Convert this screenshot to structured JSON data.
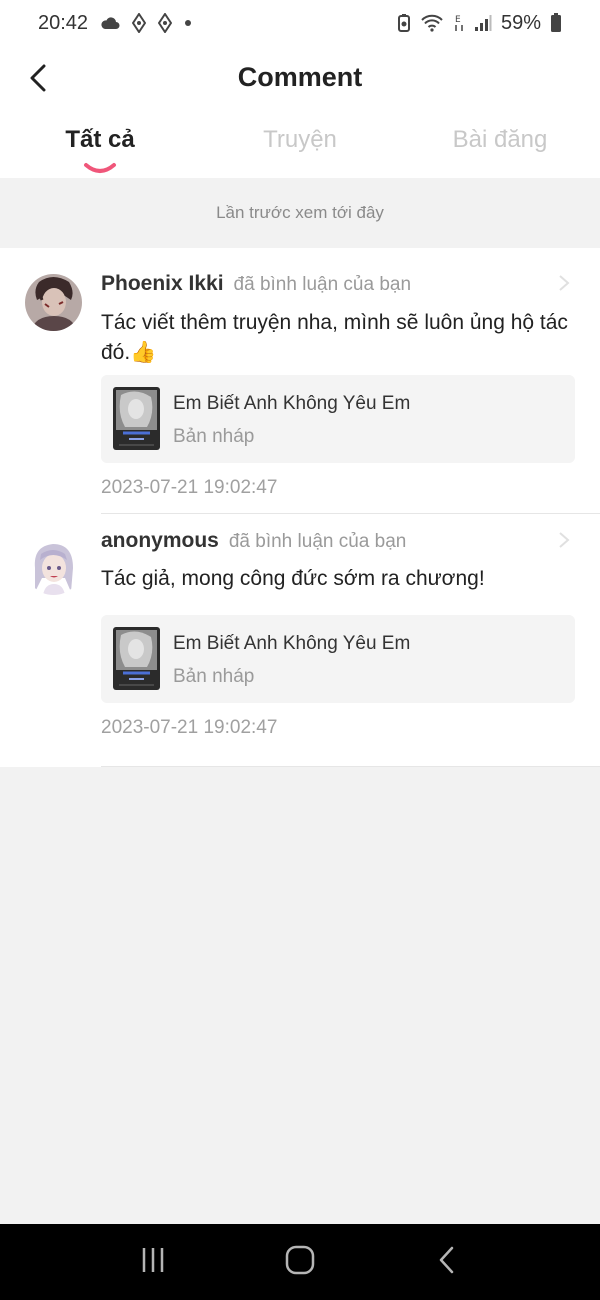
{
  "status_bar": {
    "time": "20:42",
    "battery": "59%",
    "icons": [
      "cloud-icon",
      "app-diamond-icon",
      "app-diamond-icon",
      "dot-icon",
      "battery-saver-icon",
      "wifi-icon",
      "signal-e-icon",
      "signal-icon",
      "battery-icon"
    ]
  },
  "header": {
    "title": "Comment",
    "back_icon": "back-arrow-icon"
  },
  "tabs": [
    {
      "label": "Tất cả",
      "active": true
    },
    {
      "label": "Truyện",
      "active": false
    },
    {
      "label": "Bài đăng",
      "active": false
    }
  ],
  "last_seen": "Lần trước xem tới đây",
  "comments": [
    {
      "username": "Phoenix Ikki",
      "action": "đã bình luận của bạn",
      "text": "Tác viết thêm truyện nha, mình sẽ luôn ủng hộ tác đó.👍",
      "story": {
        "title": "Em Biết Anh Không Yêu Em",
        "status": "Bản nháp"
      },
      "timestamp": "2023-07-21 19:02:47"
    },
    {
      "username": "anonymous",
      "action": "đã bình luận của bạn",
      "text": "Tác giả, mong công đức sớm ra chương!",
      "story": {
        "title": "Em Biết Anh Không Yêu Em",
        "status": "Bản nháp"
      },
      "timestamp": "2023-07-21 19:02:47"
    }
  ],
  "nav_bar": {
    "icons": [
      "recent-apps-icon",
      "home-icon",
      "back-icon"
    ]
  },
  "colors": {
    "accent": "#f0567a",
    "background": "#f2f2f2",
    "card": "#f4f4f4"
  }
}
